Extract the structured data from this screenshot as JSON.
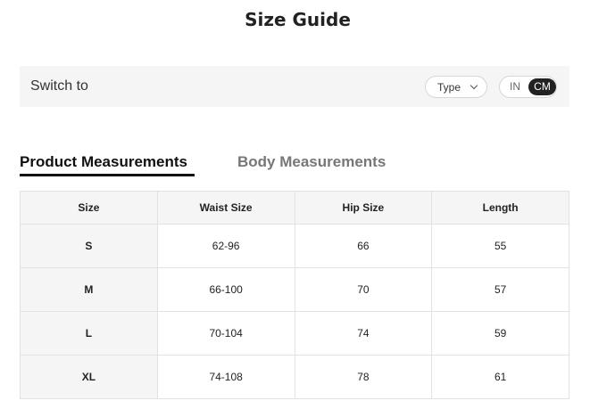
{
  "title": "Size Guide",
  "switch_bar": {
    "label": "Switch to",
    "type_select": {
      "value": "Type"
    },
    "units": {
      "in": "IN",
      "cm": "CM",
      "selected": "CM"
    }
  },
  "tabs": [
    {
      "label": "Product Measurements",
      "active": true
    },
    {
      "label": "Body Measurements",
      "active": false
    }
  ],
  "table": {
    "headers": [
      "Size",
      "Waist Size",
      "Hip Size",
      "Length"
    ],
    "rows": [
      [
        "S",
        "62-96",
        "66",
        "55"
      ],
      [
        "M",
        "66-100",
        "70",
        "57"
      ],
      [
        "L",
        "70-104",
        "74",
        "59"
      ],
      [
        "XL",
        "74-108",
        "78",
        "61"
      ]
    ]
  },
  "colors": {
    "accent": "#222222",
    "panel": "#f5f5f5",
    "inactive_tab": "#777777"
  }
}
